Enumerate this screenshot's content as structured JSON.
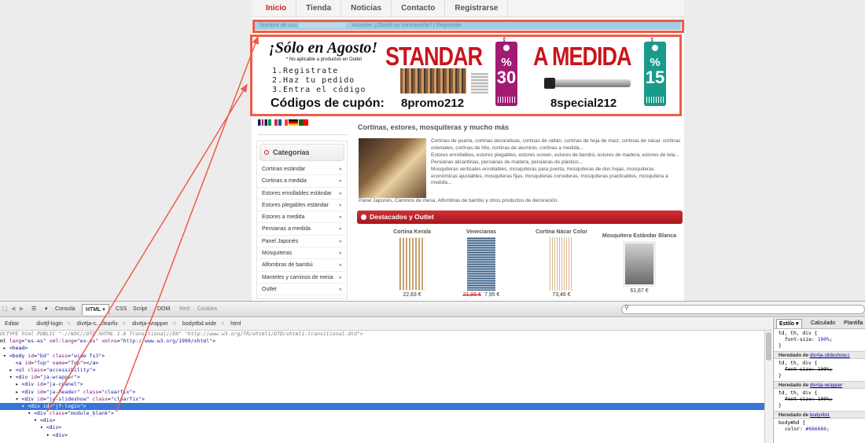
{
  "site": {
    "nav": [
      "Inicio",
      "Tienda",
      "Noticias",
      "Contacto",
      "Registrarse"
    ],
    "login_bar": {
      "user_placeholder": "Nombre de usu",
      "login_button": "Acceder",
      "forgot_text": "¿Olvidó su contraseña? | Registrate"
    },
    "banner": {
      "title": "¡Sólo en Agosto!",
      "note": "* No aplicable a productos en Outlet",
      "steps": [
        "1.Registrate",
        "2.Haz tu pedido",
        "3.Entra el código"
      ],
      "codes_label": "Códigos de cupón:",
      "offer1_title": "STANDAR",
      "offer1_pct": "%",
      "offer1_value": "30",
      "offer1_code": "8promo212",
      "offer2_title": "A MEDIDA",
      "offer2_pct": "%",
      "offer2_value": "15",
      "offer2_code": "8special212"
    },
    "categories": {
      "header": "Categorías",
      "items": [
        "Cortinas estándar",
        "Cortinas a medida",
        "Estores enrollables estándar",
        "Estores plegables estándar",
        "Estores a medida",
        "Persianas a medida",
        "Panel Japonés",
        "Mosquiteras",
        "Alfombras de bambú",
        "Manteles y caminos de mesa",
        "Outlet"
      ],
      "arrow": "▸"
    },
    "main": {
      "title": "Cortinas, estores, mosquiteras y mucho más",
      "paragraphs": [
        "Cortinas de puerta, cortinas decorativas, cortinas de rattán, cortinas de hoja de maíz, cortinas de nácar, cortinas orientales, cortinas de hilo, cortinas de aluminio, cortinas a medida...",
        "Estores enrollables, estores plegables, estores screen, estores de bambú, estores de madera, estores de tela...",
        "Persianas alicantinas, persianas de madera, persianas de plástico...",
        "Mosquiteras verticales enrollables, mosquiteras para puerta, mosquiteras de dos hojas, mosquiteras económicas ajustables, mosquiteras fijas, mosquiteras correderas, mosquiteras practicables, mosquitera a medida..."
      ],
      "footer_line": "Panel Japonés, Caminos de mesa, Alfombras de bambú y otros productos de decoración.",
      "featured_header": "Destacados y Outlet",
      "products": [
        {
          "name": "Cortina Kerala",
          "old_price": "",
          "price": "22,83 €"
        },
        {
          "name": "Venecianas",
          "old_price": "21,95 €",
          "price": "7,95 €"
        },
        {
          "name": "Cortina Nácar Color",
          "old_price": "",
          "price": "73,46 €"
        },
        {
          "name": "Mosquitera Estándar Blanca",
          "old_price": "",
          "price": "61,87 €"
        }
      ]
    }
  },
  "firebug": {
    "tabs": [
      "Consola",
      "HTML",
      "CSS",
      "Script",
      "DOM",
      "Red",
      "Cookies"
    ],
    "active_tab": "HTML",
    "edit_label": "Editar",
    "breadcrumbs": [
      "div#jf-login",
      "div#ja-s...clearfix",
      "div#ja-wrapper",
      "body#bd.wide",
      "html"
    ],
    "side_tabs": [
      "Estilo",
      "Calculado",
      "Plantilla"
    ],
    "colors": {
      "selection": "#3875d7",
      "highlight": "#ee5c49"
    }
  }
}
